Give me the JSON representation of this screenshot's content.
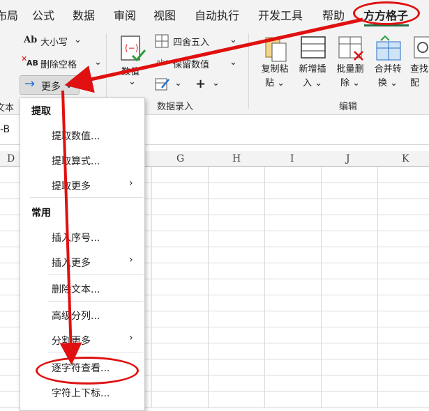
{
  "tabs": {
    "layout": "布局",
    "formula": "公式",
    "data": "数据",
    "review": "审阅",
    "view": "视图",
    "automate": "自动执行",
    "developer": "开发工具",
    "help": "帮助",
    "addin": "方方格子"
  },
  "ribbon": {
    "case": "大小写",
    "remove_space": "删除空格",
    "more": "更多",
    "text_group_partial": "文本",
    "value_btn": "数值",
    "round": "四舍五入",
    "keep_value": "保留数值",
    "data_entry_group": "数据录入",
    "copy_paste": [
      "复制粘",
      "贴"
    ],
    "add_insert": [
      "新增插",
      "入"
    ],
    "batch_delete": [
      "批量删",
      "除"
    ],
    "merge_convert": [
      "合并转",
      "换"
    ],
    "find": [
      "查找",
      "配"
    ],
    "edit_group": "编辑",
    "ab_icon": "Ab",
    "ab_sub": "AB"
  },
  "formula_bar": {
    "text": "-B"
  },
  "columns": [
    "D",
    "G",
    "H",
    "I",
    "J",
    "K"
  ],
  "menu": {
    "extract_section": "提取",
    "extract_value": "提取数值...",
    "extract_formula": "提取算式...",
    "extract_more": "提取更多",
    "common_section": "常用",
    "insert_seq": "插入序号...",
    "insert_more": "插入更多",
    "delete_text": "删除文本...",
    "advanced_split": "高级分列...",
    "split_more": "分割更多",
    "char_view": "逐字符查看...",
    "char_sub_sup": "字符上下标..."
  },
  "colors": {
    "accent_red": "#e01010",
    "ribbon_bg": "#f3f3f3",
    "active_underline": "#1f6e43"
  }
}
